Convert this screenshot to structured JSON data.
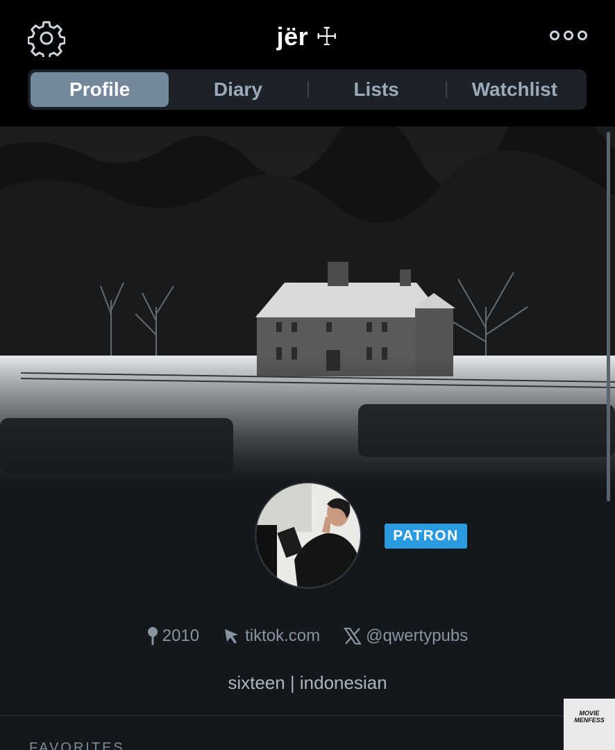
{
  "header": {
    "title": "jër ☩"
  },
  "tabs": [
    {
      "label": "Profile",
      "active": true
    },
    {
      "label": "Diary",
      "active": false
    },
    {
      "label": "Lists",
      "active": false
    },
    {
      "label": "Watchlist",
      "active": false
    }
  ],
  "profile": {
    "badge": "PATRON",
    "location": "2010",
    "website": "tiktok.com",
    "twitter": "@qwertypubs",
    "bio": "sixteen |  indonesian"
  },
  "sections": {
    "favorites_heading": "FAVORITES"
  },
  "watermark": {
    "text_line1": "MOVIE",
    "text_line2": "MENFESS"
  },
  "colors": {
    "accent": "#2a9be0",
    "active_tab": "#74889b",
    "background": "#14181c"
  },
  "icons": [
    "gear-icon",
    "more-icon",
    "location-pin-icon",
    "cursor-icon",
    "x-logo-icon"
  ]
}
